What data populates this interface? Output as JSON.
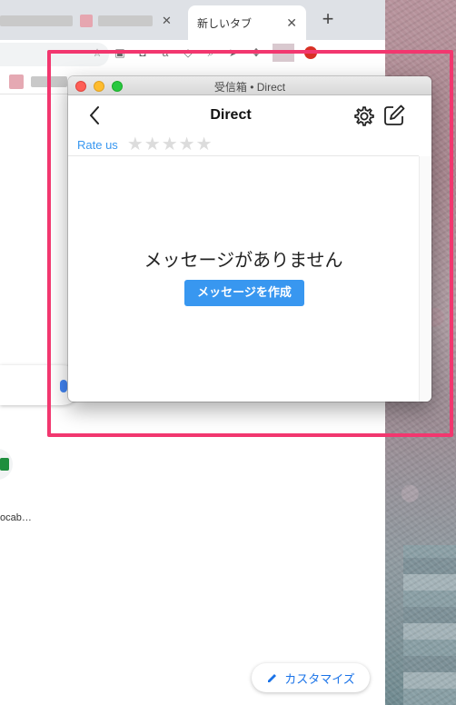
{
  "browser": {
    "active_tab_title": "新しいタブ",
    "tab_close_glyph": "✕",
    "new_tab_glyph": "+",
    "shortcut_label": "ocab…",
    "customize_label": "カスタマイズ",
    "extension_icons": [
      "star-icon",
      "save-icon",
      "pocket-icon",
      "amazon-icon",
      "tag-icon",
      "search-icon",
      "send-icon",
      "puzzle-icon"
    ]
  },
  "window": {
    "title": "受信箱 • Direct"
  },
  "app": {
    "header_title": "Direct",
    "rate_label": "Rate us",
    "stars": [
      "★",
      "★",
      "★",
      "★",
      "★"
    ],
    "empty_message": "メッセージがありません",
    "create_button_label": "メッセージを作成"
  },
  "colors": {
    "accent": "#3897f0",
    "highlight": "#f2376f"
  }
}
